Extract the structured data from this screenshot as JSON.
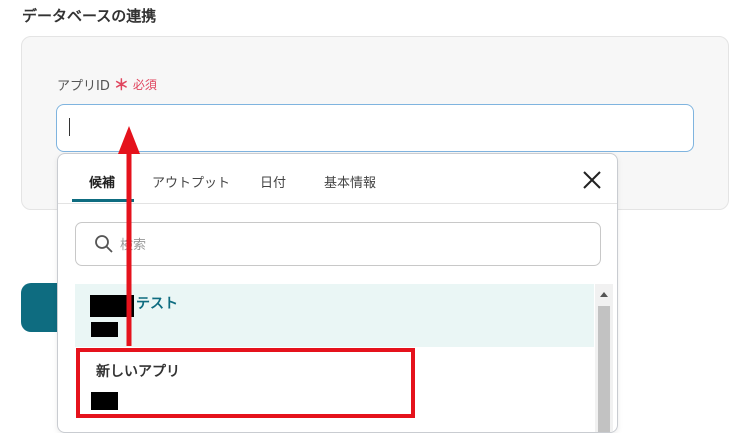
{
  "section": {
    "title": "データベースの連携"
  },
  "field": {
    "label": "アプリID",
    "required_mark": "＊",
    "required_text": "必須",
    "value": ""
  },
  "dropdown": {
    "tabs": [
      {
        "label": "候補",
        "active": true
      },
      {
        "label": "アウトプット",
        "active": false
      },
      {
        "label": "日付",
        "active": false
      },
      {
        "label": "基本情報",
        "active": false
      }
    ],
    "search": {
      "placeholder": "検索",
      "value": ""
    },
    "items": [
      {
        "title_suffix": "テスト",
        "selected": true,
        "redacted": true
      },
      {
        "title": "新しいアプリ",
        "selected": false,
        "redacted": true
      }
    ]
  },
  "colors": {
    "accent": "#0e6c80",
    "required": "#e0455e",
    "annotation": "#e5121c",
    "input_border": "#7fb4df",
    "selected_row": "#eaf6f5"
  },
  "icons": {
    "close": "close-icon",
    "search": "search-icon"
  }
}
